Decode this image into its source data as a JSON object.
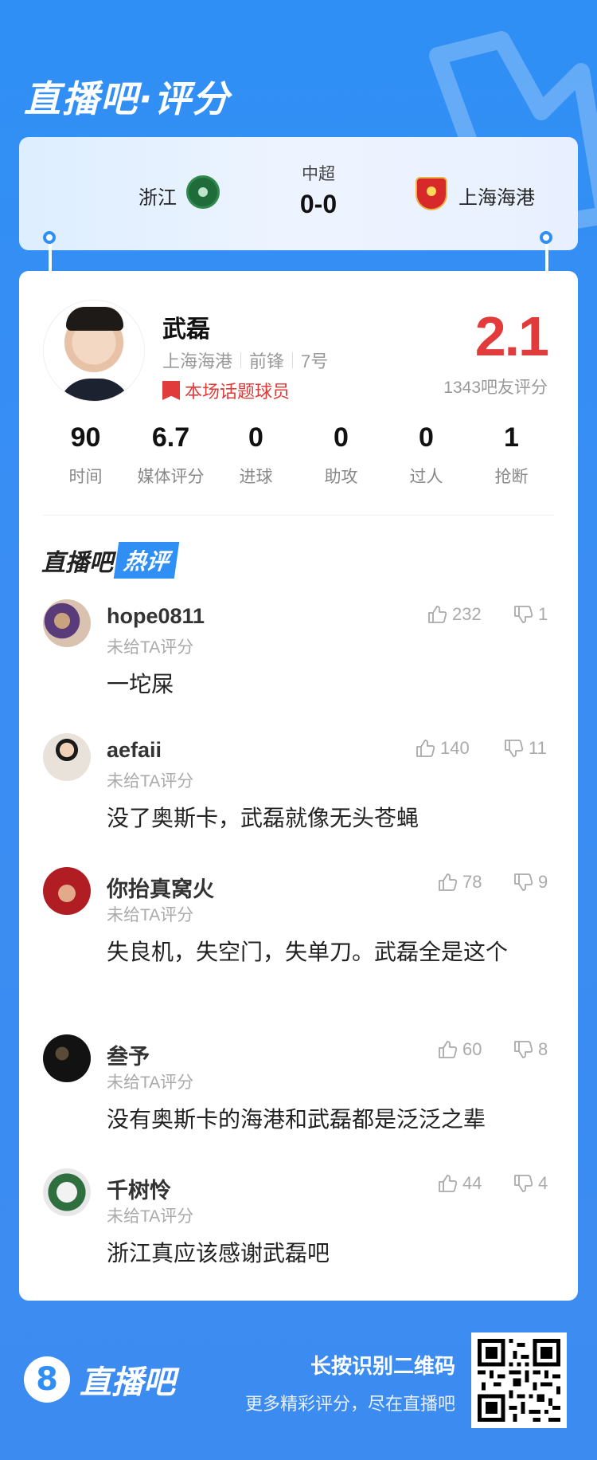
{
  "app": {
    "title": "直播吧·评分"
  },
  "match": {
    "home_team": "浙江",
    "league": "中超",
    "score": "0-0",
    "away_team": "上海海港"
  },
  "player": {
    "name": "武磊",
    "team": "上海海港",
    "position": "前锋",
    "number": "7号",
    "topic_tag": "本场话题球员",
    "rating": "2.1",
    "rating_count": "1343吧友评分"
  },
  "stats": [
    {
      "value": "90",
      "label": "时间"
    },
    {
      "value": "6.7",
      "label": "媒体评分"
    },
    {
      "value": "0",
      "label": "进球"
    },
    {
      "value": "0",
      "label": "助攻"
    },
    {
      "value": "0",
      "label": "过人"
    },
    {
      "value": "1",
      "label": "抢断"
    }
  ],
  "hot": {
    "title_a": "直播吧",
    "title_b": "热评"
  },
  "comments": [
    {
      "user": "hope0811",
      "sub": "未给TA评分",
      "text": "一坨屎",
      "likes": "232",
      "dislikes": "1"
    },
    {
      "user": "aefaii",
      "sub": "未给TA评分",
      "text": "没了奥斯卡，武磊就像无头苍蝇",
      "likes": "140",
      "dislikes": "11"
    },
    {
      "user": "你抬真窝火",
      "sub": "未给TA评分",
      "text": "失良机，失空门，失单刀。武磊全是这个",
      "likes": "78",
      "dislikes": "9"
    },
    {
      "user": "叁予",
      "sub": "未给TA评分",
      "text": "没有奥斯卡的海港和武磊都是泛泛之辈",
      "likes": "60",
      "dislikes": "8"
    },
    {
      "user": "千树怜",
      "sub": "未给TA评分",
      "text": "浙江真应该感谢武磊吧",
      "likes": "44",
      "dislikes": "4"
    }
  ],
  "footer": {
    "logo_text": "直播吧",
    "qr_title": "长按识别二维码",
    "qr_sub": "更多精彩评分，尽在直播吧"
  },
  "colors": {
    "accent": "#2f8ff5",
    "rating": "#e23b3b"
  }
}
